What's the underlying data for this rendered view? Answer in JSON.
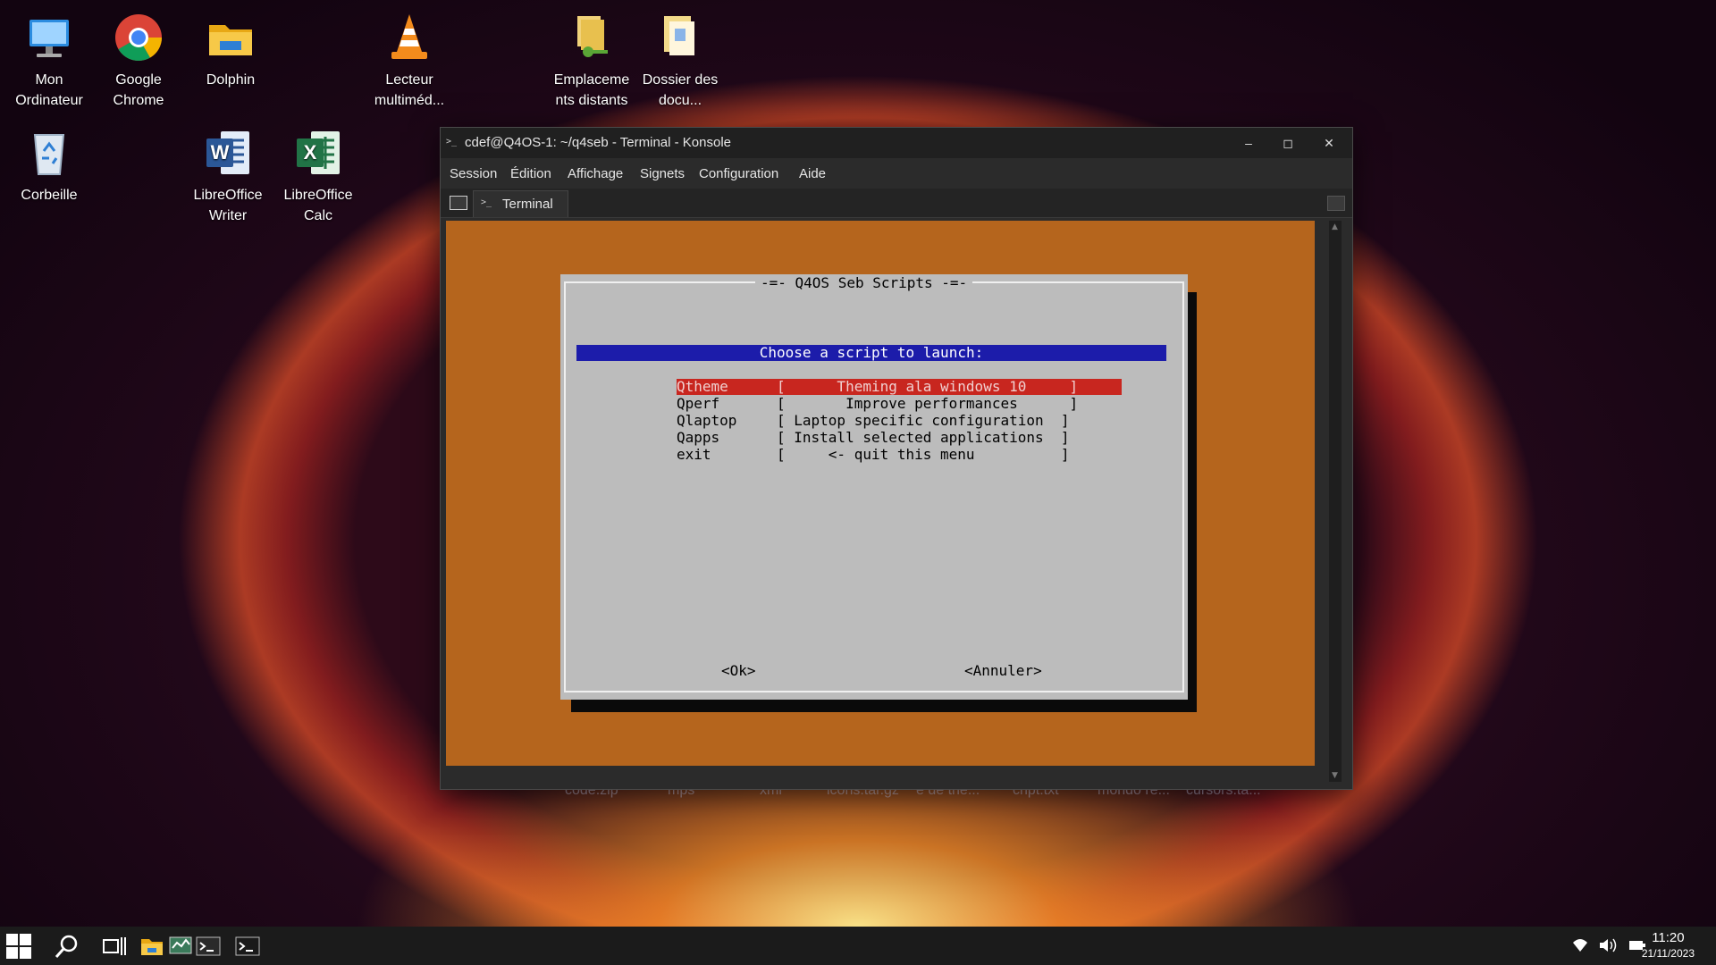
{
  "desktop": {
    "icons": [
      {
        "label": "Mon Ordinateur"
      },
      {
        "label": "Google Chrome"
      },
      {
        "label": "Dolphin"
      },
      {
        "label": "Lecteur multiméd..."
      },
      {
        "label": "Emplaceme nts distants"
      },
      {
        "label": "Dossier des docu..."
      },
      {
        "label": "Corbeille"
      },
      {
        "label": "LibreOffice Writer"
      },
      {
        "label": "LibreOffice Calc"
      }
    ],
    "background_files": [
      "code.zip",
      "mps",
      "xml",
      "icons.tar.gz",
      "e de the...",
      "cript.txt",
      "mondo re...",
      "cursors.ta..."
    ]
  },
  "window": {
    "title": "cdef@Q4OS-1: ~/q4seb - Terminal - Konsole",
    "menu": [
      "Session",
      "Édition",
      "Affichage",
      "Signets",
      "Configuration",
      "Aide"
    ],
    "tab_label": "Terminal"
  },
  "dialog": {
    "title": "-=- Q4OS Seb Scripts -=-",
    "prompt": "Choose a script to launch:",
    "items": [
      {
        "tag": "Qtheme",
        "desc": "[      Theming ala windows 10     ]",
        "selected": true
      },
      {
        "tag": "Qperf",
        "desc": "[       Improve performances      ]",
        "selected": false
      },
      {
        "tag": "Qlaptop",
        "desc": "[ Laptop specific configuration  ]",
        "selected": false
      },
      {
        "tag": "Qapps",
        "desc": "[ Install selected applications  ]",
        "selected": false
      },
      {
        "tag": "exit",
        "desc": "[     <- quit this menu          ]",
        "selected": false
      }
    ],
    "ok_label": "<Ok>",
    "cancel_label": "<Annuler>"
  },
  "taskbar": {
    "time": "11:20",
    "date": "21/11/2023"
  },
  "colors": {
    "terminal_bg": "#b5651d",
    "dialog_bg": "#bcbcbc",
    "prompt_bg": "#1c1caa",
    "selection_bg": "#c8261f"
  }
}
